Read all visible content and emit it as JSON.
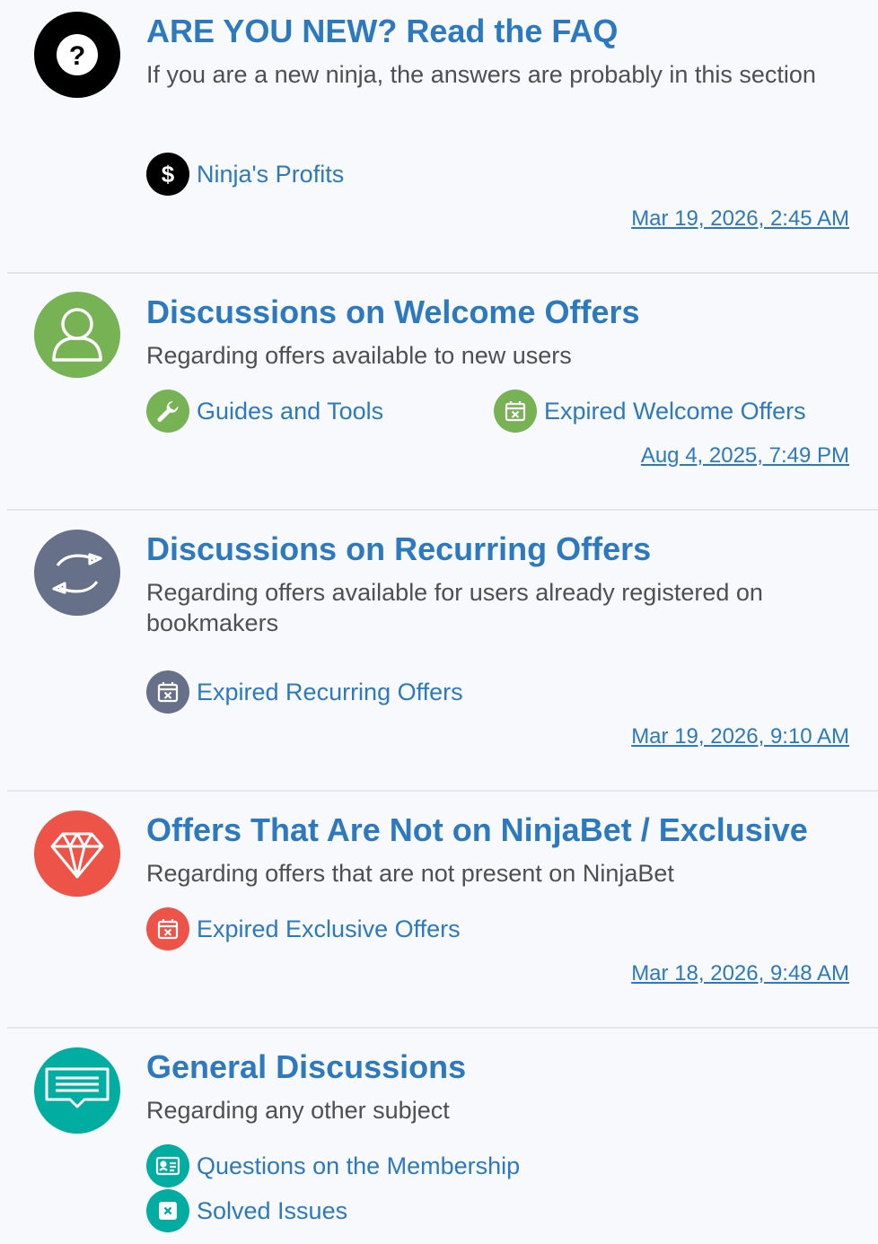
{
  "colors": {
    "link": "#2d79bf",
    "black_icon": "#000000",
    "green_icon": "#77b255",
    "slate_icon": "#667088",
    "red_icon": "#ee5347",
    "teal_icon": "#00ada0"
  },
  "forums": [
    {
      "title": "ARE YOU NEW? Read the FAQ",
      "description": "If you are a new ninja, the answers are probably in this section",
      "icon": "question-mark-icon",
      "subforums": [
        {
          "label": "Ninja's Profits",
          "icon": "dollar-icon"
        }
      ],
      "last_post": "Mar 19, 2026, 2:45 AM"
    },
    {
      "title": "Discussions on Welcome Offers",
      "description": "Regarding offers available to new users",
      "icon": "user-icon",
      "subforums": [
        {
          "label": "Guides and Tools",
          "icon": "wrench-icon"
        },
        {
          "label": "Expired Welcome Offers",
          "icon": "calendar-x-icon"
        }
      ],
      "last_post": "Aug 4, 2025, 7:49 PM"
    },
    {
      "title": "Discussions on Recurring Offers",
      "description": "Regarding offers available for users already registered on bookmakers",
      "icon": "refresh-icon",
      "subforums": [
        {
          "label": "Expired Recurring Offers",
          "icon": "calendar-x-icon"
        }
      ],
      "last_post": "Mar 19, 2026, 9:10 AM"
    },
    {
      "title": "Offers That Are Not on NinjaBet / Exclusive",
      "description": "Regarding offers that are not present on NinjaBet",
      "icon": "diamond-icon",
      "subforums": [
        {
          "label": "Expired Exclusive Offers",
          "icon": "calendar-x-icon"
        }
      ],
      "last_post": "Mar 18, 2026, 9:48 AM"
    },
    {
      "title": "General Discussions",
      "description": "Regarding any other subject",
      "icon": "chat-icon",
      "subforums": [
        {
          "label": "Questions on the Membership",
          "icon": "id-card-icon"
        },
        {
          "label": "Solved Issues",
          "icon": "x-square-icon"
        }
      ]
    }
  ]
}
